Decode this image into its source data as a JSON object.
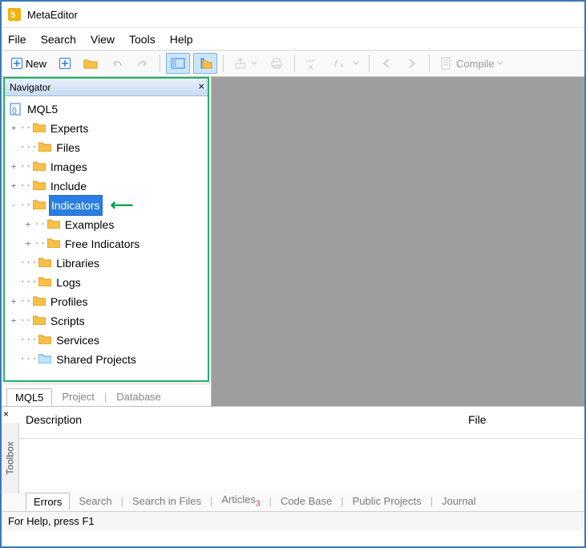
{
  "app": {
    "title": "MetaEditor"
  },
  "menu": {
    "items": [
      "File",
      "Search",
      "View",
      "Tools",
      "Help"
    ]
  },
  "toolbar": {
    "new_label": "New",
    "compile_label": "Compile"
  },
  "navigator": {
    "title": "Navigator",
    "root": "MQL5",
    "items": [
      {
        "label": "Experts",
        "exp": "+"
      },
      {
        "label": "Files",
        "exp": ""
      },
      {
        "label": "Images",
        "exp": "+"
      },
      {
        "label": "Include",
        "exp": "+"
      },
      {
        "label": "Indicators",
        "exp": "-",
        "selected": true,
        "children": [
          {
            "label": "Examples",
            "exp": "+"
          },
          {
            "label": "Free Indicators",
            "exp": "+"
          }
        ]
      },
      {
        "label": "Libraries",
        "exp": ""
      },
      {
        "label": "Logs",
        "exp": ""
      },
      {
        "label": "Profiles",
        "exp": "+"
      },
      {
        "label": "Scripts",
        "exp": "+"
      },
      {
        "label": "Services",
        "exp": ""
      },
      {
        "label": "Shared Projects",
        "exp": "",
        "blue": true
      }
    ],
    "tabs": [
      "MQL5",
      "Project",
      "Database"
    ]
  },
  "toolbox": {
    "side_label": "Toolbox",
    "columns": [
      "Description",
      "File"
    ],
    "tabs": [
      "Errors",
      "Search",
      "Search in Files",
      "Articles",
      "Code Base",
      "Public Projects",
      "Journal"
    ],
    "articles_badge": "3"
  },
  "status": {
    "text": "For Help, press F1"
  }
}
